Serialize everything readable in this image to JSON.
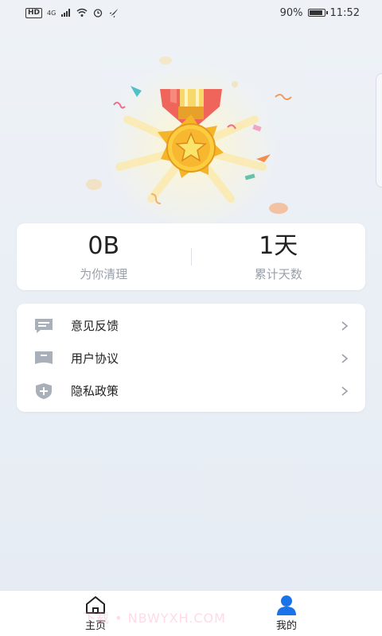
{
  "status": {
    "battery": "90%",
    "time": "11:52",
    "hd": "HD",
    "network": "4G",
    "battery_level": 0.9
  },
  "stats": {
    "cleaned_value": "0B",
    "cleaned_label": "为你清理",
    "days_value": "1天",
    "days_label": "累计天数"
  },
  "menu": [
    {
      "label": "意见反馈",
      "icon": "chat-icon"
    },
    {
      "label": "用户协议",
      "icon": "book-icon"
    },
    {
      "label": "隐私政策",
      "icon": "shield-plus-icon"
    }
  ],
  "nav": {
    "home_label": "主页",
    "mine_label": "我的"
  },
  "watermark": "下载 • NBWYXH.COM",
  "colors": {
    "accent": "#1a73e8",
    "gold": "#f5b52a",
    "ribbon_red": "#f0655b"
  }
}
